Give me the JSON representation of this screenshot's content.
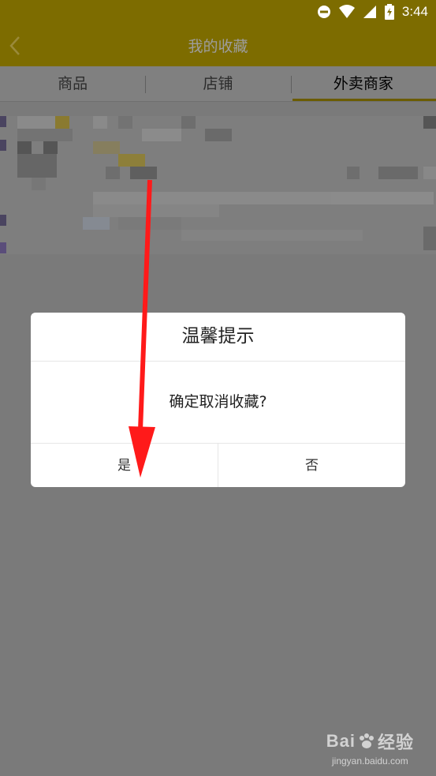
{
  "statusbar": {
    "time": "3:44"
  },
  "appbar": {
    "title": "我的收藏"
  },
  "tabs": [
    {
      "label": "商品",
      "active": false
    },
    {
      "label": "店铺",
      "active": false
    },
    {
      "label": "外卖商家",
      "active": true
    }
  ],
  "dialog": {
    "title": "温馨提示",
    "message": "确定取消收藏?",
    "confirm_label": "是",
    "cancel_label": "否"
  },
  "watermark": {
    "brand_left": "Bai",
    "brand_right": "经验",
    "url": "jingyan.baidu.com"
  },
  "colors": {
    "header": "#7d6c00",
    "overlay": "#7a7a7a",
    "arrow": "#ff1a1a",
    "tab_indicator": "#6b5c00"
  }
}
